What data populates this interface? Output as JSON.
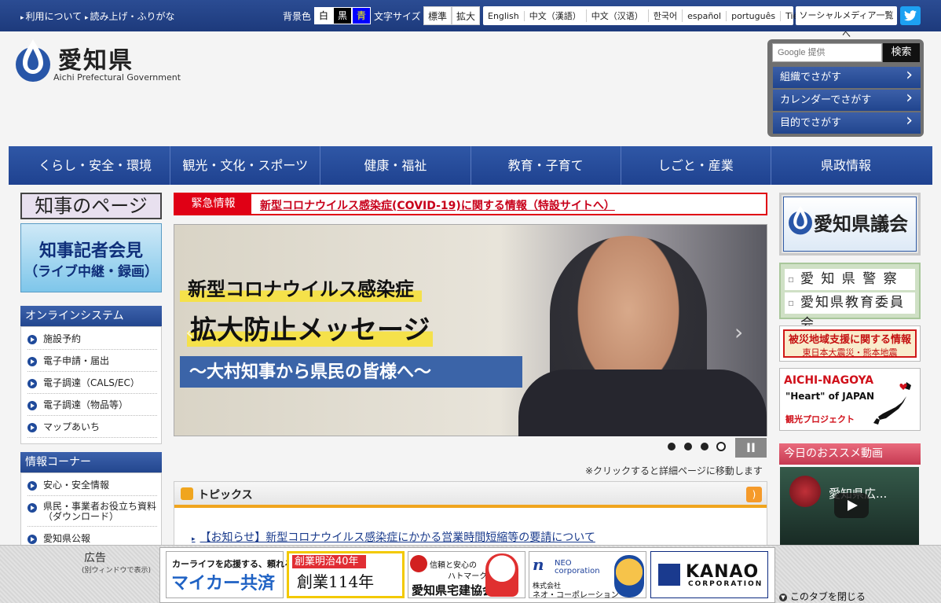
{
  "topbar": {
    "links": [
      "利用について",
      "読み上げ・ふりがな"
    ],
    "bg_label": "背景色",
    "bg_options": [
      {
        "label": "白",
        "bg": "#ffffff",
        "fg": "#000000"
      },
      {
        "label": "黒",
        "bg": "#000000",
        "fg": "#ffffff"
      },
      {
        "label": "青",
        "bg": "#0000ff",
        "fg": "#ffff00"
      }
    ],
    "size_label": "文字サイズ",
    "size_options": [
      "標準",
      "拡大"
    ],
    "languages": [
      "English",
      "中文（漢語）",
      "中文（汉语）",
      "한국어",
      "español",
      "português",
      "Tiếng Việt"
    ],
    "social_link": "ソーシャルメディア一覧へ",
    "twitter_icon": "twitter-icon"
  },
  "logo": {
    "name_jp": "愛知県",
    "name_en": "Aichi Prefectural Government"
  },
  "search": {
    "placeholder": "Google 提供",
    "button": "検索"
  },
  "quick_links": [
    "組織でさがす",
    "カレンダーでさがす",
    "目的でさがす"
  ],
  "nav": [
    "くらし・安全・環境",
    "観光・文化・スポーツ",
    "健康・福祉",
    "教育・子育て",
    "しごと・産業",
    "県政情報"
  ],
  "left": {
    "governor_page": "知事のページ",
    "press": {
      "line1": "知事記者会見",
      "line2": "（ライブ中継・録画）"
    },
    "online": {
      "title": "オンラインシステム",
      "items": [
        "施設予約",
        "電子申請・届出",
        "電子調達（CALS/EC）",
        "電子調達（物品等）",
        "マップあいち"
      ]
    },
    "info": {
      "title": "情報コーナー",
      "items": [
        "安心・安全情報",
        "県民・事業者お役立ち資料（ダウンロード）",
        "愛知県公報"
      ]
    }
  },
  "emergency": {
    "label": "緊急情報",
    "text": "新型コロナウイルス感染症(COVID-19)に関する情報（特設サイトへ）"
  },
  "slide": {
    "line1": "新型コロナウイルス感染症",
    "line2": "拡大防止メッセージ",
    "line3": "～大村知事から県民の皆様へ～",
    "dots": 4,
    "active_dot": 4,
    "pause_icon": "pause-icon",
    "note": "※クリックすると詳細ページに移動します"
  },
  "topics": {
    "title": "トピックス",
    "items": [
      "【お知らせ】新型コロナウイルス感染症にかかる営業時間短縮等の要請について"
    ]
  },
  "right": {
    "assembly": "愛知県議会",
    "police": "愛 知 県 警 察",
    "education": "愛知県教育委員会",
    "disaster": {
      "line1": "被災地域支援に関する情報",
      "line2": "東日本大震災・熊本地震"
    },
    "aichi_nagoya": {
      "line1": "AICHI-NAGOYA",
      "line2": "\"Heart\" of JAPAN",
      "line3": "観光プロジェクト"
    },
    "recommend": "今日のおススメ動画",
    "video_title": "愛知県広..."
  },
  "ads": {
    "label": "広告",
    "sub": "(別ウィンドウで表示)",
    "ad1": {
      "top": "カーライフを応援する、頼れる補償",
      "main": "マイカー共済"
    },
    "ad2": {
      "top": "創業明治40年",
      "main": "創業114年"
    },
    "ad3": {
      "top1": "信頼と安心の",
      "top2": "ハトマーク",
      "main": "愛知県宅建協会"
    },
    "ad4": {
      "logo": "n",
      "t1": "NEO",
      "t2": "corporation",
      "t3": "株式会社",
      "t4": "ネオ・コーポレーション"
    },
    "ad5": {
      "name": "KANAO",
      "sub": "CORPORATION"
    },
    "close": "このタブを閉じる"
  }
}
